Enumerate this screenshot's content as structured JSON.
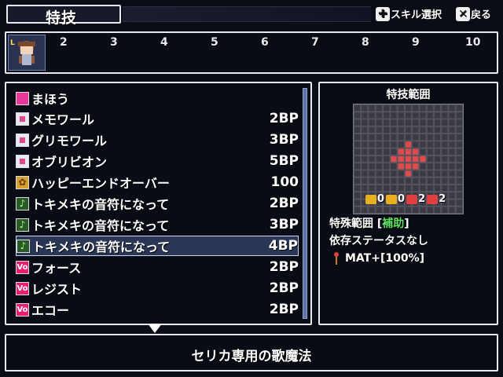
{
  "header": {
    "title": "特技",
    "hint_skill_label": "スキル選択",
    "hint_back_label": "戻る",
    "hint_skill_icon": "dpad-icon",
    "hint_back_icon": "x-button-icon"
  },
  "party": {
    "slot_numbers": [
      "2",
      "3",
      "4",
      "5",
      "6",
      "7",
      "8",
      "9",
      "10"
    ]
  },
  "skills": [
    {
      "name": "まほう",
      "cost": "",
      "icon": "magic-category-icon"
    },
    {
      "name": "メモワール",
      "cost": "2BP",
      "icon": "skill-pink-icon"
    },
    {
      "name": "グリモワール",
      "cost": "3BP",
      "icon": "skill-pink-icon"
    },
    {
      "name": "オブリビオン",
      "cost": "5BP",
      "icon": "skill-pink-icon"
    },
    {
      "name": "ハッピーエンドオーバー",
      "cost": "100",
      "icon": "skill-gold-icon"
    },
    {
      "name": "トキメキの音符になって",
      "cost": "2BP",
      "icon": "music-note-icon"
    },
    {
      "name": "トキメキの音符になって",
      "cost": "3BP",
      "icon": "music-note-icon"
    },
    {
      "name": "トキメキの音符になって",
      "cost": "4BP",
      "icon": "music-note-icon",
      "selected": true
    },
    {
      "name": "フォース",
      "cost": "2BP",
      "icon": "vo-icon"
    },
    {
      "name": "レジスト",
      "cost": "2BP",
      "icon": "vo-icon"
    },
    {
      "name": "エコー",
      "cost": "2BP",
      "icon": "vo-icon"
    }
  ],
  "range_panel": {
    "title": "特技範囲",
    "modifiers": [
      {
        "icon": "up-arrow-icon",
        "color": "#e8b020",
        "value": "0"
      },
      {
        "icon": "down-arrow-icon",
        "color": "#e8b020",
        "value": "0"
      },
      {
        "icon": "up-arrow-icon",
        "color": "#e04040",
        "value": "2"
      },
      {
        "icon": "down-arrow-icon",
        "color": "#e04040",
        "value": "2"
      }
    ],
    "range_label_prefix": "特殊範囲 [",
    "range_label_tag": "補助",
    "range_label_suffix": "]",
    "dependency_text": "依存ステータスなし",
    "stat_text": "MAT+[100%]",
    "grid_highlight_color": "#e04a4a",
    "grid_cell_color": "#3a3a44"
  },
  "description": "セリカ専用の歌魔法"
}
